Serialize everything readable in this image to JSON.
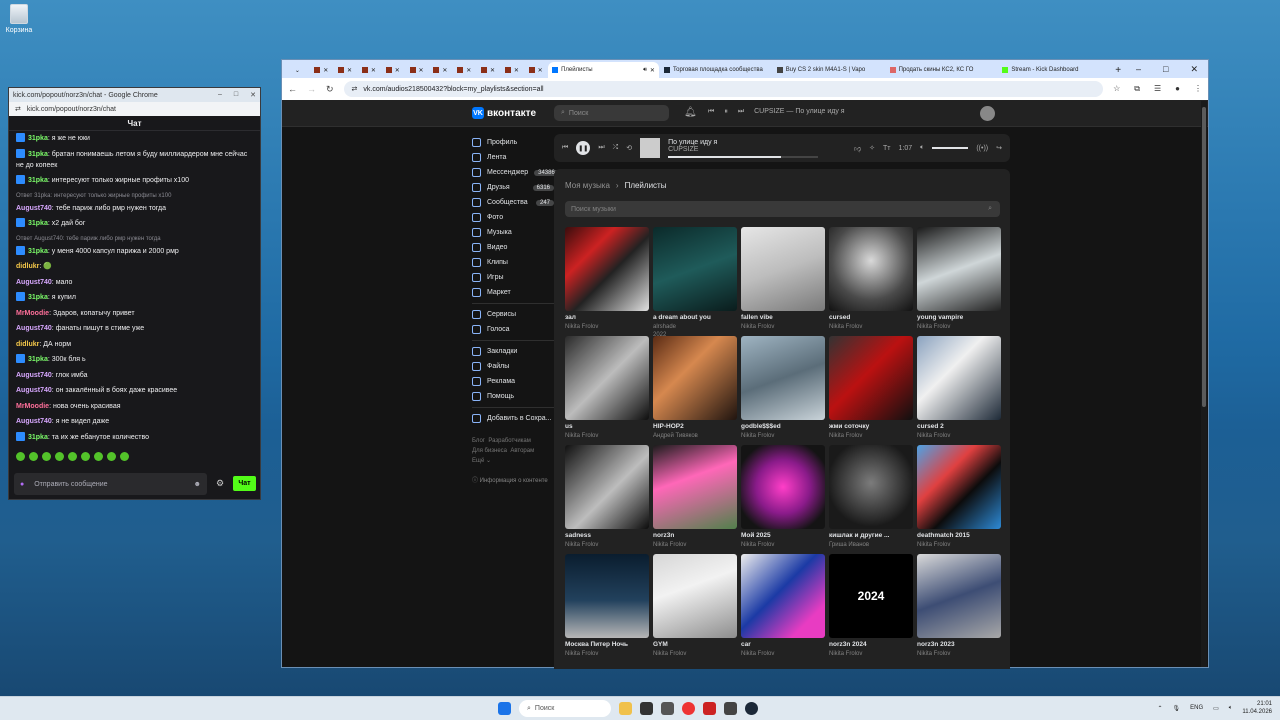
{
  "desktop": {
    "recycle_bin": "Корзина"
  },
  "chat_window": {
    "title": "kick.com/popout/norz3n/chat - Google Chrome",
    "url": "kick.com/popout/norz3n/chat",
    "header": "Чат",
    "messages": [
      {
        "user": "31pka",
        "color": "#7cfc6a",
        "badge": true,
        "text": "я же не юки"
      },
      {
        "user": "31pka",
        "color": "#7cfc6a",
        "badge": true,
        "text": "братан понимаешь летом я буду миллиардером мне сейчас не до копеек"
      },
      {
        "user": "31pka",
        "color": "#7cfc6a",
        "badge": true,
        "text": "интересуют только жирные профиты х100"
      },
      {
        "reply": "Ответ 31pka: интересуют только жирные профиты х100",
        "user": "August740",
        "color": "#d8a8ff",
        "badge": false,
        "text": "тебе париж либо рмр нужен тогда"
      },
      {
        "user": "31pka",
        "color": "#7cfc6a",
        "badge": true,
        "text": "х2 дай бог"
      },
      {
        "reply": "Ответ August740: тебе париж либо рмр нужен тогда",
        "user": "31pka",
        "color": "#7cfc6a",
        "badge": true,
        "text": "у меня 4000 капсул парижа и 2000 рмр"
      },
      {
        "user": "didlukr",
        "color": "#f5c84a",
        "badge": false,
        "text": "🟢"
      },
      {
        "user": "August740",
        "color": "#d8a8ff",
        "badge": false,
        "text": "мало"
      },
      {
        "user": "31pka",
        "color": "#7cfc6a",
        "badge": true,
        "text": "я купил"
      },
      {
        "user": "MrMoodie",
        "color": "#ff6f9a",
        "badge": false,
        "text": "Здаров, копатычу привет"
      },
      {
        "user": "August740",
        "color": "#d8a8ff",
        "badge": false,
        "text": "фанаты пишут в стиме уже"
      },
      {
        "user": "didlukr",
        "color": "#f5c84a",
        "badge": false,
        "text": "ДА норм"
      },
      {
        "user": "31pka",
        "color": "#7cfc6a",
        "badge": true,
        "text": "300к бля ь"
      },
      {
        "user": "August740",
        "color": "#d8a8ff",
        "badge": false,
        "text": "глок имба"
      },
      {
        "user": "August740",
        "color": "#d8a8ff",
        "badge": false,
        "text": "он закалённый в боях даже красивее"
      },
      {
        "user": "MrMoodie",
        "color": "#ff6f9a",
        "badge": false,
        "text": "нова очень красивая"
      },
      {
        "user": "August740",
        "color": "#d8a8ff",
        "badge": false,
        "text": "я не видел даже"
      },
      {
        "user": "31pka",
        "color": "#7cfc6a",
        "badge": true,
        "text": "та их же ебанутое количество"
      }
    ],
    "input_placeholder": "Отправить сообщение",
    "send_label": "Чат"
  },
  "browser": {
    "active_tab": "Плейлисты",
    "tabs": [
      "Торговая площадка сообщества",
      "Buy CS 2 skin M4A1-S | Vapo",
      "Продать скины КС2, КС ГО",
      "Stream - Kick Dashboard"
    ],
    "url": "vk.com/audios218500432?block=my_playlists&section=all"
  },
  "vk": {
    "logo": "вконтакте",
    "search_placeholder": "Поиск",
    "mini_track": "CUPSIZE — По улице иду я",
    "nav": [
      {
        "label": "Профиль"
      },
      {
        "label": "Лента"
      },
      {
        "label": "Мессенджер",
        "count": "34386"
      },
      {
        "label": "Друзья",
        "count": "6316"
      },
      {
        "label": "Сообщества",
        "count": "247"
      },
      {
        "label": "Фото"
      },
      {
        "label": "Музыка"
      },
      {
        "label": "Видео"
      },
      {
        "label": "Клипы"
      },
      {
        "label": "Игры"
      },
      {
        "label": "Маркет"
      }
    ],
    "nav2": [
      {
        "label": "Сервисы"
      },
      {
        "label": "Голоса"
      }
    ],
    "nav3": [
      {
        "label": "Закладки"
      },
      {
        "label": "Файлы"
      },
      {
        "label": "Реклама"
      },
      {
        "label": "Помощь"
      }
    ],
    "nav4": [
      {
        "label": "Добавить в Сохра..."
      }
    ],
    "footer": [
      "Блог",
      "Разработчикам",
      "Для бизнеса",
      "Авторам",
      "Ещё"
    ],
    "info": "Информация о контенте",
    "player": {
      "title": "По улице иду я",
      "artist": "CUPSIZE",
      "time": "1:07",
      "progress": 0.75
    },
    "breadcrumb": {
      "root": "Моя музыка",
      "current": "Плейлисты"
    },
    "music_search_placeholder": "Поиск музыки",
    "playlists": [
      {
        "title": "зал",
        "author": "Nikita Frolov",
        "bg": "linear-gradient(135deg,#3a0d0d,#c22 30%,#222 55%,#e0e0e0)"
      },
      {
        "title": "a dream about you",
        "author": "alrshade",
        "year": "2022",
        "bg": "linear-gradient(160deg,#0b2a2a,#1f5b5a 50%,#0a1c1c)"
      },
      {
        "title": "fallen vibe",
        "author": "Nikita Frolov",
        "bg": "linear-gradient(160deg,#e6e6e6,#bdbdbd 50%,#7a7a7a)"
      },
      {
        "title": "cursed",
        "author": "Nikita Frolov",
        "bg": "radial-gradient(circle at 50% 40%,#d9d9d9,#4a4a4a 60%,#111)"
      },
      {
        "title": "young vampire",
        "author": "Nikita Frolov",
        "bg": "linear-gradient(160deg,#1a1a1a,#cfd6d8 50%,#222)"
      },
      {
        "title": "us",
        "author": "Nikita Frolov",
        "bg": "linear-gradient(135deg,#2a2a2a,#bcbcbc 50%,#0e0e0e)"
      },
      {
        "title": "HIP-HOP2",
        "author": "Андрей Тивяков",
        "bg": "linear-gradient(135deg,#5a2b14,#d6884f 40%,#20140f)"
      },
      {
        "title": "godble$$$ed",
        "author": "Nikita Frolov",
        "bg": "linear-gradient(160deg,#9fb4c2,#5b6d79 50%,#c9d3d9)"
      },
      {
        "title": "жми соточку",
        "author": "Nikita Frolov",
        "bg": "linear-gradient(135deg,#333,#b11 45%,#101010)"
      },
      {
        "title": "cursed 2",
        "author": "Nikita Frolov",
        "bg": "linear-gradient(135deg,#8aa2bf,#f0f0f0 40%,#1e2a38)"
      },
      {
        "title": "sadness",
        "author": "Nikita Frolov",
        "bg": "linear-gradient(135deg,#111,#bdbdbd 55%,#0c0c0c)"
      },
      {
        "title": "norz3n",
        "author": "Nikita Frolov",
        "bg": "linear-gradient(160deg,#1c1c1c,#ff67b8 40%,#51804b)"
      },
      {
        "title": "Мой 2025",
        "author": "Nikita Frolov",
        "bg": "radial-gradient(circle,#ff3ec8 0,#8a1b8a 45%,#141414 80%)"
      },
      {
        "title": "кишлак и другие ...",
        "author": "Гриша Иванов",
        "bg": "radial-gradient(circle at 50% 45%,#7c7c7c,#1a1a1a 70%)"
      },
      {
        "title": "deathmatch 2015",
        "author": "Nikita Frolov",
        "bg": "linear-gradient(135deg,#4da2e5,#e04040 35%,#0c0c0c 60%,#2d8ad6)"
      },
      {
        "title": "Москва Питер Ночь",
        "author": "Nikita Frolov",
        "bg": "linear-gradient(180deg,#0a1d2e,#22415d 55%,#b7b7b7)"
      },
      {
        "title": "GYM",
        "author": "Nikita Frolov",
        "bg": "linear-gradient(160deg,#d6d6d6,#f2f2f2 40%,#8d8d8d)"
      },
      {
        "title": "car",
        "author": "Nikita Frolov",
        "bg": "linear-gradient(135deg,#eee,#1b3aa5 45%,#e83cc2 80%)"
      },
      {
        "title": "norz3n 2024",
        "author": "Nikita Frolov",
        "bg": "#000",
        "text": "2024"
      },
      {
        "title": "norz3n 2023",
        "author": "Nikita Frolov",
        "bg": "linear-gradient(160deg,#dadada,#3d4d74 50%,#a8a8a8)"
      }
    ]
  },
  "taskbar": {
    "search": "Поиск",
    "lang": "ENG",
    "time": "21:01",
    "date": "11.04.2026"
  }
}
